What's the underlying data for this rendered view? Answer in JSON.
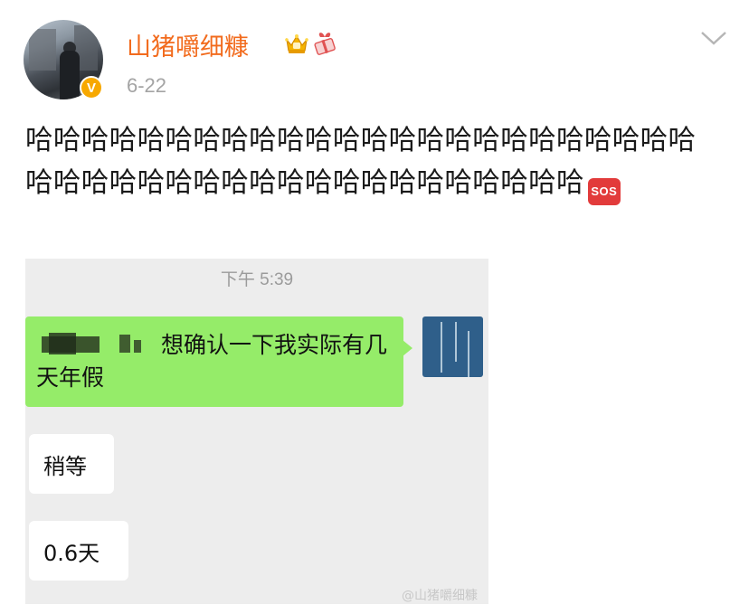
{
  "post": {
    "username": "山猪嚼细糠",
    "date": "6-22",
    "verified_badge": "V",
    "text": "哈哈哈哈哈哈哈哈哈哈哈哈哈哈哈哈哈哈哈哈哈哈哈哈哈哈哈哈哈哈哈哈哈哈哈哈哈哈哈哈哈哈哈哈",
    "emoji": "SOS",
    "icons": [
      "crown-icon",
      "gift-icon",
      "chevron-down-icon",
      "sos-icon"
    ]
  },
  "chat": {
    "time": "下午 5:39",
    "messages": [
      {
        "side": "right",
        "text": "想确认一下我实际有几天年假"
      },
      {
        "side": "left",
        "text": "稍等"
      },
      {
        "side": "left",
        "text": "0.6天"
      }
    ]
  },
  "watermark": "@山猪嚼细糠",
  "colors": {
    "username": "#f26b1d",
    "bubble_green": "#95ec69",
    "chat_bg": "#ededed",
    "verified": "#f7a800"
  }
}
